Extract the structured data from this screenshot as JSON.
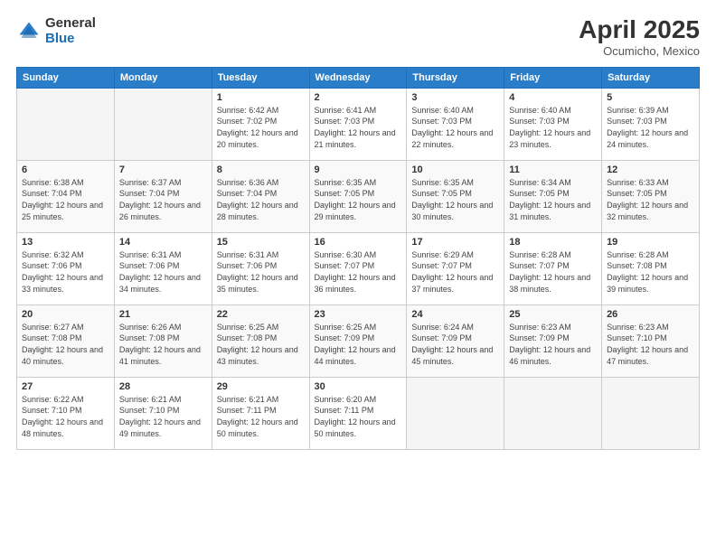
{
  "logo": {
    "general": "General",
    "blue": "Blue"
  },
  "header": {
    "month": "April 2025",
    "location": "Ocumicho, Mexico"
  },
  "weekdays": [
    "Sunday",
    "Monday",
    "Tuesday",
    "Wednesday",
    "Thursday",
    "Friday",
    "Saturday"
  ],
  "weeks": [
    [
      {
        "day": "",
        "sunrise": "",
        "sunset": "",
        "daylight": ""
      },
      {
        "day": "",
        "sunrise": "",
        "sunset": "",
        "daylight": ""
      },
      {
        "day": "1",
        "sunrise": "Sunrise: 6:42 AM",
        "sunset": "Sunset: 7:02 PM",
        "daylight": "Daylight: 12 hours and 20 minutes."
      },
      {
        "day": "2",
        "sunrise": "Sunrise: 6:41 AM",
        "sunset": "Sunset: 7:03 PM",
        "daylight": "Daylight: 12 hours and 21 minutes."
      },
      {
        "day": "3",
        "sunrise": "Sunrise: 6:40 AM",
        "sunset": "Sunset: 7:03 PM",
        "daylight": "Daylight: 12 hours and 22 minutes."
      },
      {
        "day": "4",
        "sunrise": "Sunrise: 6:40 AM",
        "sunset": "Sunset: 7:03 PM",
        "daylight": "Daylight: 12 hours and 23 minutes."
      },
      {
        "day": "5",
        "sunrise": "Sunrise: 6:39 AM",
        "sunset": "Sunset: 7:03 PM",
        "daylight": "Daylight: 12 hours and 24 minutes."
      }
    ],
    [
      {
        "day": "6",
        "sunrise": "Sunrise: 6:38 AM",
        "sunset": "Sunset: 7:04 PM",
        "daylight": "Daylight: 12 hours and 25 minutes."
      },
      {
        "day": "7",
        "sunrise": "Sunrise: 6:37 AM",
        "sunset": "Sunset: 7:04 PM",
        "daylight": "Daylight: 12 hours and 26 minutes."
      },
      {
        "day": "8",
        "sunrise": "Sunrise: 6:36 AM",
        "sunset": "Sunset: 7:04 PM",
        "daylight": "Daylight: 12 hours and 28 minutes."
      },
      {
        "day": "9",
        "sunrise": "Sunrise: 6:35 AM",
        "sunset": "Sunset: 7:05 PM",
        "daylight": "Daylight: 12 hours and 29 minutes."
      },
      {
        "day": "10",
        "sunrise": "Sunrise: 6:35 AM",
        "sunset": "Sunset: 7:05 PM",
        "daylight": "Daylight: 12 hours and 30 minutes."
      },
      {
        "day": "11",
        "sunrise": "Sunrise: 6:34 AM",
        "sunset": "Sunset: 7:05 PM",
        "daylight": "Daylight: 12 hours and 31 minutes."
      },
      {
        "day": "12",
        "sunrise": "Sunrise: 6:33 AM",
        "sunset": "Sunset: 7:05 PM",
        "daylight": "Daylight: 12 hours and 32 minutes."
      }
    ],
    [
      {
        "day": "13",
        "sunrise": "Sunrise: 6:32 AM",
        "sunset": "Sunset: 7:06 PM",
        "daylight": "Daylight: 12 hours and 33 minutes."
      },
      {
        "day": "14",
        "sunrise": "Sunrise: 6:31 AM",
        "sunset": "Sunset: 7:06 PM",
        "daylight": "Daylight: 12 hours and 34 minutes."
      },
      {
        "day": "15",
        "sunrise": "Sunrise: 6:31 AM",
        "sunset": "Sunset: 7:06 PM",
        "daylight": "Daylight: 12 hours and 35 minutes."
      },
      {
        "day": "16",
        "sunrise": "Sunrise: 6:30 AM",
        "sunset": "Sunset: 7:07 PM",
        "daylight": "Daylight: 12 hours and 36 minutes."
      },
      {
        "day": "17",
        "sunrise": "Sunrise: 6:29 AM",
        "sunset": "Sunset: 7:07 PM",
        "daylight": "Daylight: 12 hours and 37 minutes."
      },
      {
        "day": "18",
        "sunrise": "Sunrise: 6:28 AM",
        "sunset": "Sunset: 7:07 PM",
        "daylight": "Daylight: 12 hours and 38 minutes."
      },
      {
        "day": "19",
        "sunrise": "Sunrise: 6:28 AM",
        "sunset": "Sunset: 7:08 PM",
        "daylight": "Daylight: 12 hours and 39 minutes."
      }
    ],
    [
      {
        "day": "20",
        "sunrise": "Sunrise: 6:27 AM",
        "sunset": "Sunset: 7:08 PM",
        "daylight": "Daylight: 12 hours and 40 minutes."
      },
      {
        "day": "21",
        "sunrise": "Sunrise: 6:26 AM",
        "sunset": "Sunset: 7:08 PM",
        "daylight": "Daylight: 12 hours and 41 minutes."
      },
      {
        "day": "22",
        "sunrise": "Sunrise: 6:25 AM",
        "sunset": "Sunset: 7:08 PM",
        "daylight": "Daylight: 12 hours and 43 minutes."
      },
      {
        "day": "23",
        "sunrise": "Sunrise: 6:25 AM",
        "sunset": "Sunset: 7:09 PM",
        "daylight": "Daylight: 12 hours and 44 minutes."
      },
      {
        "day": "24",
        "sunrise": "Sunrise: 6:24 AM",
        "sunset": "Sunset: 7:09 PM",
        "daylight": "Daylight: 12 hours and 45 minutes."
      },
      {
        "day": "25",
        "sunrise": "Sunrise: 6:23 AM",
        "sunset": "Sunset: 7:09 PM",
        "daylight": "Daylight: 12 hours and 46 minutes."
      },
      {
        "day": "26",
        "sunrise": "Sunrise: 6:23 AM",
        "sunset": "Sunset: 7:10 PM",
        "daylight": "Daylight: 12 hours and 47 minutes."
      }
    ],
    [
      {
        "day": "27",
        "sunrise": "Sunrise: 6:22 AM",
        "sunset": "Sunset: 7:10 PM",
        "daylight": "Daylight: 12 hours and 48 minutes."
      },
      {
        "day": "28",
        "sunrise": "Sunrise: 6:21 AM",
        "sunset": "Sunset: 7:10 PM",
        "daylight": "Daylight: 12 hours and 49 minutes."
      },
      {
        "day": "29",
        "sunrise": "Sunrise: 6:21 AM",
        "sunset": "Sunset: 7:11 PM",
        "daylight": "Daylight: 12 hours and 50 minutes."
      },
      {
        "day": "30",
        "sunrise": "Sunrise: 6:20 AM",
        "sunset": "Sunset: 7:11 PM",
        "daylight": "Daylight: 12 hours and 50 minutes."
      },
      {
        "day": "",
        "sunrise": "",
        "sunset": "",
        "daylight": ""
      },
      {
        "day": "",
        "sunrise": "",
        "sunset": "",
        "daylight": ""
      },
      {
        "day": "",
        "sunrise": "",
        "sunset": "",
        "daylight": ""
      }
    ]
  ]
}
